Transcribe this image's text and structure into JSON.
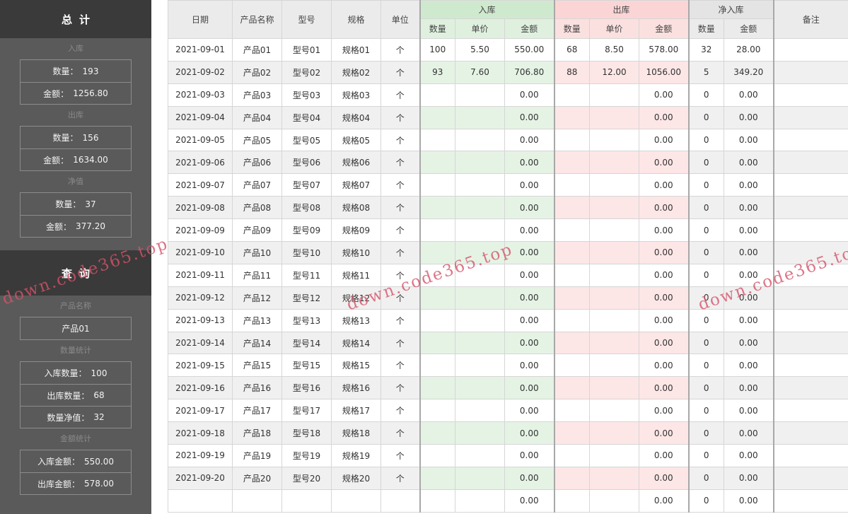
{
  "sidebar": {
    "total": {
      "title": "总计",
      "in_label": "入库",
      "in_qty": {
        "label": "数量：",
        "value": "193"
      },
      "in_amount": {
        "label": "金额：",
        "value": "1256.80"
      },
      "out_label": "出库",
      "out_qty": {
        "label": "数量：",
        "value": "156"
      },
      "out_amount": {
        "label": "金额：",
        "value": "1634.00"
      },
      "net_label": "净值",
      "net_qty": {
        "label": "数量：",
        "value": "37"
      },
      "net_amount": {
        "label": "金额：",
        "value": "377.20"
      }
    },
    "query": {
      "title": "查询",
      "product_label": "产品名称",
      "product_value": "产品01",
      "qty_stats_label": "数量统计",
      "in_qty": {
        "label": "入库数量：",
        "value": "100"
      },
      "out_qty": {
        "label": "出库数量：",
        "value": "68"
      },
      "net_qty": {
        "label": "数量净值：",
        "value": "32"
      },
      "amount_stats_label": "金额统计",
      "in_amount": {
        "label": "入库金额：",
        "value": "550.00"
      },
      "out_amount": {
        "label": "出库金额：",
        "value": "578.00"
      }
    }
  },
  "table": {
    "headers": {
      "date": "日期",
      "product": "产品名称",
      "model": "型号",
      "spec": "规格",
      "unit": "单位",
      "in_group": "入库",
      "out_group": "出库",
      "net_group": "净入库",
      "note": "备注",
      "qty": "数量",
      "price": "单价",
      "amount": "金额"
    },
    "rows": [
      {
        "date": "2021-09-01",
        "product": "产品01",
        "model": "型号01",
        "spec": "规格01",
        "unit": "个",
        "in_qty": "100",
        "in_price": "5.50",
        "in_amount": "550.00",
        "out_qty": "68",
        "out_price": "8.50",
        "out_amount": "578.00",
        "net_qty": "32",
        "net_amount": "28.00",
        "note": ""
      },
      {
        "date": "2021-09-02",
        "product": "产品02",
        "model": "型号02",
        "spec": "规格02",
        "unit": "个",
        "in_qty": "93",
        "in_price": "7.60",
        "in_amount": "706.80",
        "out_qty": "88",
        "out_price": "12.00",
        "out_amount": "1056.00",
        "net_qty": "5",
        "net_amount": "349.20",
        "note": ""
      },
      {
        "date": "2021-09-03",
        "product": "产品03",
        "model": "型号03",
        "spec": "规格03",
        "unit": "个",
        "in_qty": "",
        "in_price": "",
        "in_amount": "0.00",
        "out_qty": "",
        "out_price": "",
        "out_amount": "0.00",
        "net_qty": "0",
        "net_amount": "0.00",
        "note": ""
      },
      {
        "date": "2021-09-04",
        "product": "产品04",
        "model": "型号04",
        "spec": "规格04",
        "unit": "个",
        "in_qty": "",
        "in_price": "",
        "in_amount": "0.00",
        "out_qty": "",
        "out_price": "",
        "out_amount": "0.00",
        "net_qty": "0",
        "net_amount": "0.00",
        "note": ""
      },
      {
        "date": "2021-09-05",
        "product": "产品05",
        "model": "型号05",
        "spec": "规格05",
        "unit": "个",
        "in_qty": "",
        "in_price": "",
        "in_amount": "0.00",
        "out_qty": "",
        "out_price": "",
        "out_amount": "0.00",
        "net_qty": "0",
        "net_amount": "0.00",
        "note": ""
      },
      {
        "date": "2021-09-06",
        "product": "产品06",
        "model": "型号06",
        "spec": "规格06",
        "unit": "个",
        "in_qty": "",
        "in_price": "",
        "in_amount": "0.00",
        "out_qty": "",
        "out_price": "",
        "out_amount": "0.00",
        "net_qty": "0",
        "net_amount": "0.00",
        "note": ""
      },
      {
        "date": "2021-09-07",
        "product": "产品07",
        "model": "型号07",
        "spec": "规格07",
        "unit": "个",
        "in_qty": "",
        "in_price": "",
        "in_amount": "0.00",
        "out_qty": "",
        "out_price": "",
        "out_amount": "0.00",
        "net_qty": "0",
        "net_amount": "0.00",
        "note": ""
      },
      {
        "date": "2021-09-08",
        "product": "产品08",
        "model": "型号08",
        "spec": "规格08",
        "unit": "个",
        "in_qty": "",
        "in_price": "",
        "in_amount": "0.00",
        "out_qty": "",
        "out_price": "",
        "out_amount": "0.00",
        "net_qty": "0",
        "net_amount": "0.00",
        "note": ""
      },
      {
        "date": "2021-09-09",
        "product": "产品09",
        "model": "型号09",
        "spec": "规格09",
        "unit": "个",
        "in_qty": "",
        "in_price": "",
        "in_amount": "0.00",
        "out_qty": "",
        "out_price": "",
        "out_amount": "0.00",
        "net_qty": "0",
        "net_amount": "0.00",
        "note": ""
      },
      {
        "date": "2021-09-10",
        "product": "产品10",
        "model": "型号10",
        "spec": "规格10",
        "unit": "个",
        "in_qty": "",
        "in_price": "",
        "in_amount": "0.00",
        "out_qty": "",
        "out_price": "",
        "out_amount": "0.00",
        "net_qty": "0",
        "net_amount": "0.00",
        "note": ""
      },
      {
        "date": "2021-09-11",
        "product": "产品11",
        "model": "型号11",
        "spec": "规格11",
        "unit": "个",
        "in_qty": "",
        "in_price": "",
        "in_amount": "0.00",
        "out_qty": "",
        "out_price": "",
        "out_amount": "0.00",
        "net_qty": "0",
        "net_amount": "0.00",
        "note": ""
      },
      {
        "date": "2021-09-12",
        "product": "产品12",
        "model": "型号12",
        "spec": "规格12",
        "unit": "个",
        "in_qty": "",
        "in_price": "",
        "in_amount": "0.00",
        "out_qty": "",
        "out_price": "",
        "out_amount": "0.00",
        "net_qty": "0",
        "net_amount": "0.00",
        "note": ""
      },
      {
        "date": "2021-09-13",
        "product": "产品13",
        "model": "型号13",
        "spec": "规格13",
        "unit": "个",
        "in_qty": "",
        "in_price": "",
        "in_amount": "0.00",
        "out_qty": "",
        "out_price": "",
        "out_amount": "0.00",
        "net_qty": "0",
        "net_amount": "0.00",
        "note": ""
      },
      {
        "date": "2021-09-14",
        "product": "产品14",
        "model": "型号14",
        "spec": "规格14",
        "unit": "个",
        "in_qty": "",
        "in_price": "",
        "in_amount": "0.00",
        "out_qty": "",
        "out_price": "",
        "out_amount": "0.00",
        "net_qty": "0",
        "net_amount": "0.00",
        "note": ""
      },
      {
        "date": "2021-09-15",
        "product": "产品15",
        "model": "型号15",
        "spec": "规格15",
        "unit": "个",
        "in_qty": "",
        "in_price": "",
        "in_amount": "0.00",
        "out_qty": "",
        "out_price": "",
        "out_amount": "0.00",
        "net_qty": "0",
        "net_amount": "0.00",
        "note": ""
      },
      {
        "date": "2021-09-16",
        "product": "产品16",
        "model": "型号16",
        "spec": "规格16",
        "unit": "个",
        "in_qty": "",
        "in_price": "",
        "in_amount": "0.00",
        "out_qty": "",
        "out_price": "",
        "out_amount": "0.00",
        "net_qty": "0",
        "net_amount": "0.00",
        "note": ""
      },
      {
        "date": "2021-09-17",
        "product": "产品17",
        "model": "型号17",
        "spec": "规格17",
        "unit": "个",
        "in_qty": "",
        "in_price": "",
        "in_amount": "0.00",
        "out_qty": "",
        "out_price": "",
        "out_amount": "0.00",
        "net_qty": "0",
        "net_amount": "0.00",
        "note": ""
      },
      {
        "date": "2021-09-18",
        "product": "产品18",
        "model": "型号18",
        "spec": "规格18",
        "unit": "个",
        "in_qty": "",
        "in_price": "",
        "in_amount": "0.00",
        "out_qty": "",
        "out_price": "",
        "out_amount": "0.00",
        "net_qty": "0",
        "net_amount": "0.00",
        "note": ""
      },
      {
        "date": "2021-09-19",
        "product": "产品19",
        "model": "型号19",
        "spec": "规格19",
        "unit": "个",
        "in_qty": "",
        "in_price": "",
        "in_amount": "0.00",
        "out_qty": "",
        "out_price": "",
        "out_amount": "0.00",
        "net_qty": "0",
        "net_amount": "0.00",
        "note": ""
      },
      {
        "date": "2021-09-20",
        "product": "产品20",
        "model": "型号20",
        "spec": "规格20",
        "unit": "个",
        "in_qty": "",
        "in_price": "",
        "in_amount": "0.00",
        "out_qty": "",
        "out_price": "",
        "out_amount": "0.00",
        "net_qty": "0",
        "net_amount": "0.00",
        "note": ""
      },
      {
        "date": "",
        "product": "",
        "model": "",
        "spec": "",
        "unit": "",
        "in_qty": "",
        "in_price": "",
        "in_amount": "0.00",
        "out_qty": "",
        "out_price": "",
        "out_amount": "0.00",
        "net_qty": "0",
        "net_amount": "0.00",
        "note": ""
      }
    ]
  },
  "watermark": {
    "text": "down.code365.top"
  }
}
